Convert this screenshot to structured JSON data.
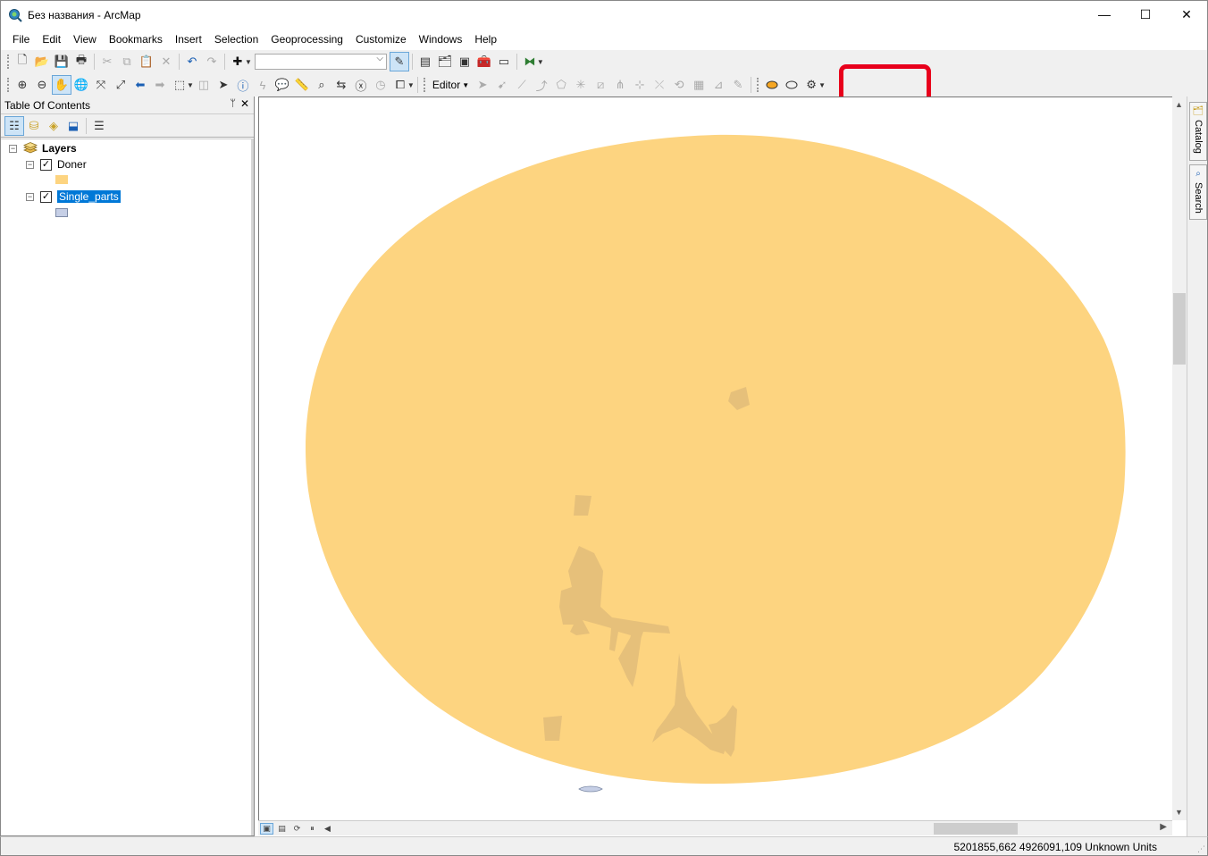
{
  "window": {
    "title": "Без названия - ArcMap",
    "minimize": "—",
    "maximize": "☐",
    "close": "✕"
  },
  "menu": [
    "File",
    "Edit",
    "View",
    "Bookmarks",
    "Insert",
    "Selection",
    "Geoprocessing",
    "Customize",
    "Windows",
    "Help"
  ],
  "toolbar": {
    "editor_label": "Editor",
    "scale_value": ""
  },
  "toc": {
    "title": "Table Of Contents",
    "pin": "ᛘ",
    "close": "✕",
    "root_label": "Layers",
    "layers": [
      {
        "name": "Doner",
        "checked": true,
        "swatch": "#fdd480"
      },
      {
        "name": "Single_parts",
        "checked": true,
        "swatch": "#c6cfe6",
        "selected": true
      }
    ]
  },
  "dock": {
    "catalog_label": "Catalog",
    "search_label": "Search"
  },
  "status": {
    "coordinates": "5201855,662  4926091,109 Unknown Units"
  },
  "colors": {
    "ellipse_fill": "#fdd480",
    "parts_fill": "#e6c07a",
    "small_feature_fill": "#c6cfe6",
    "highlight": "#e8001c",
    "selection": "#0078d7"
  }
}
